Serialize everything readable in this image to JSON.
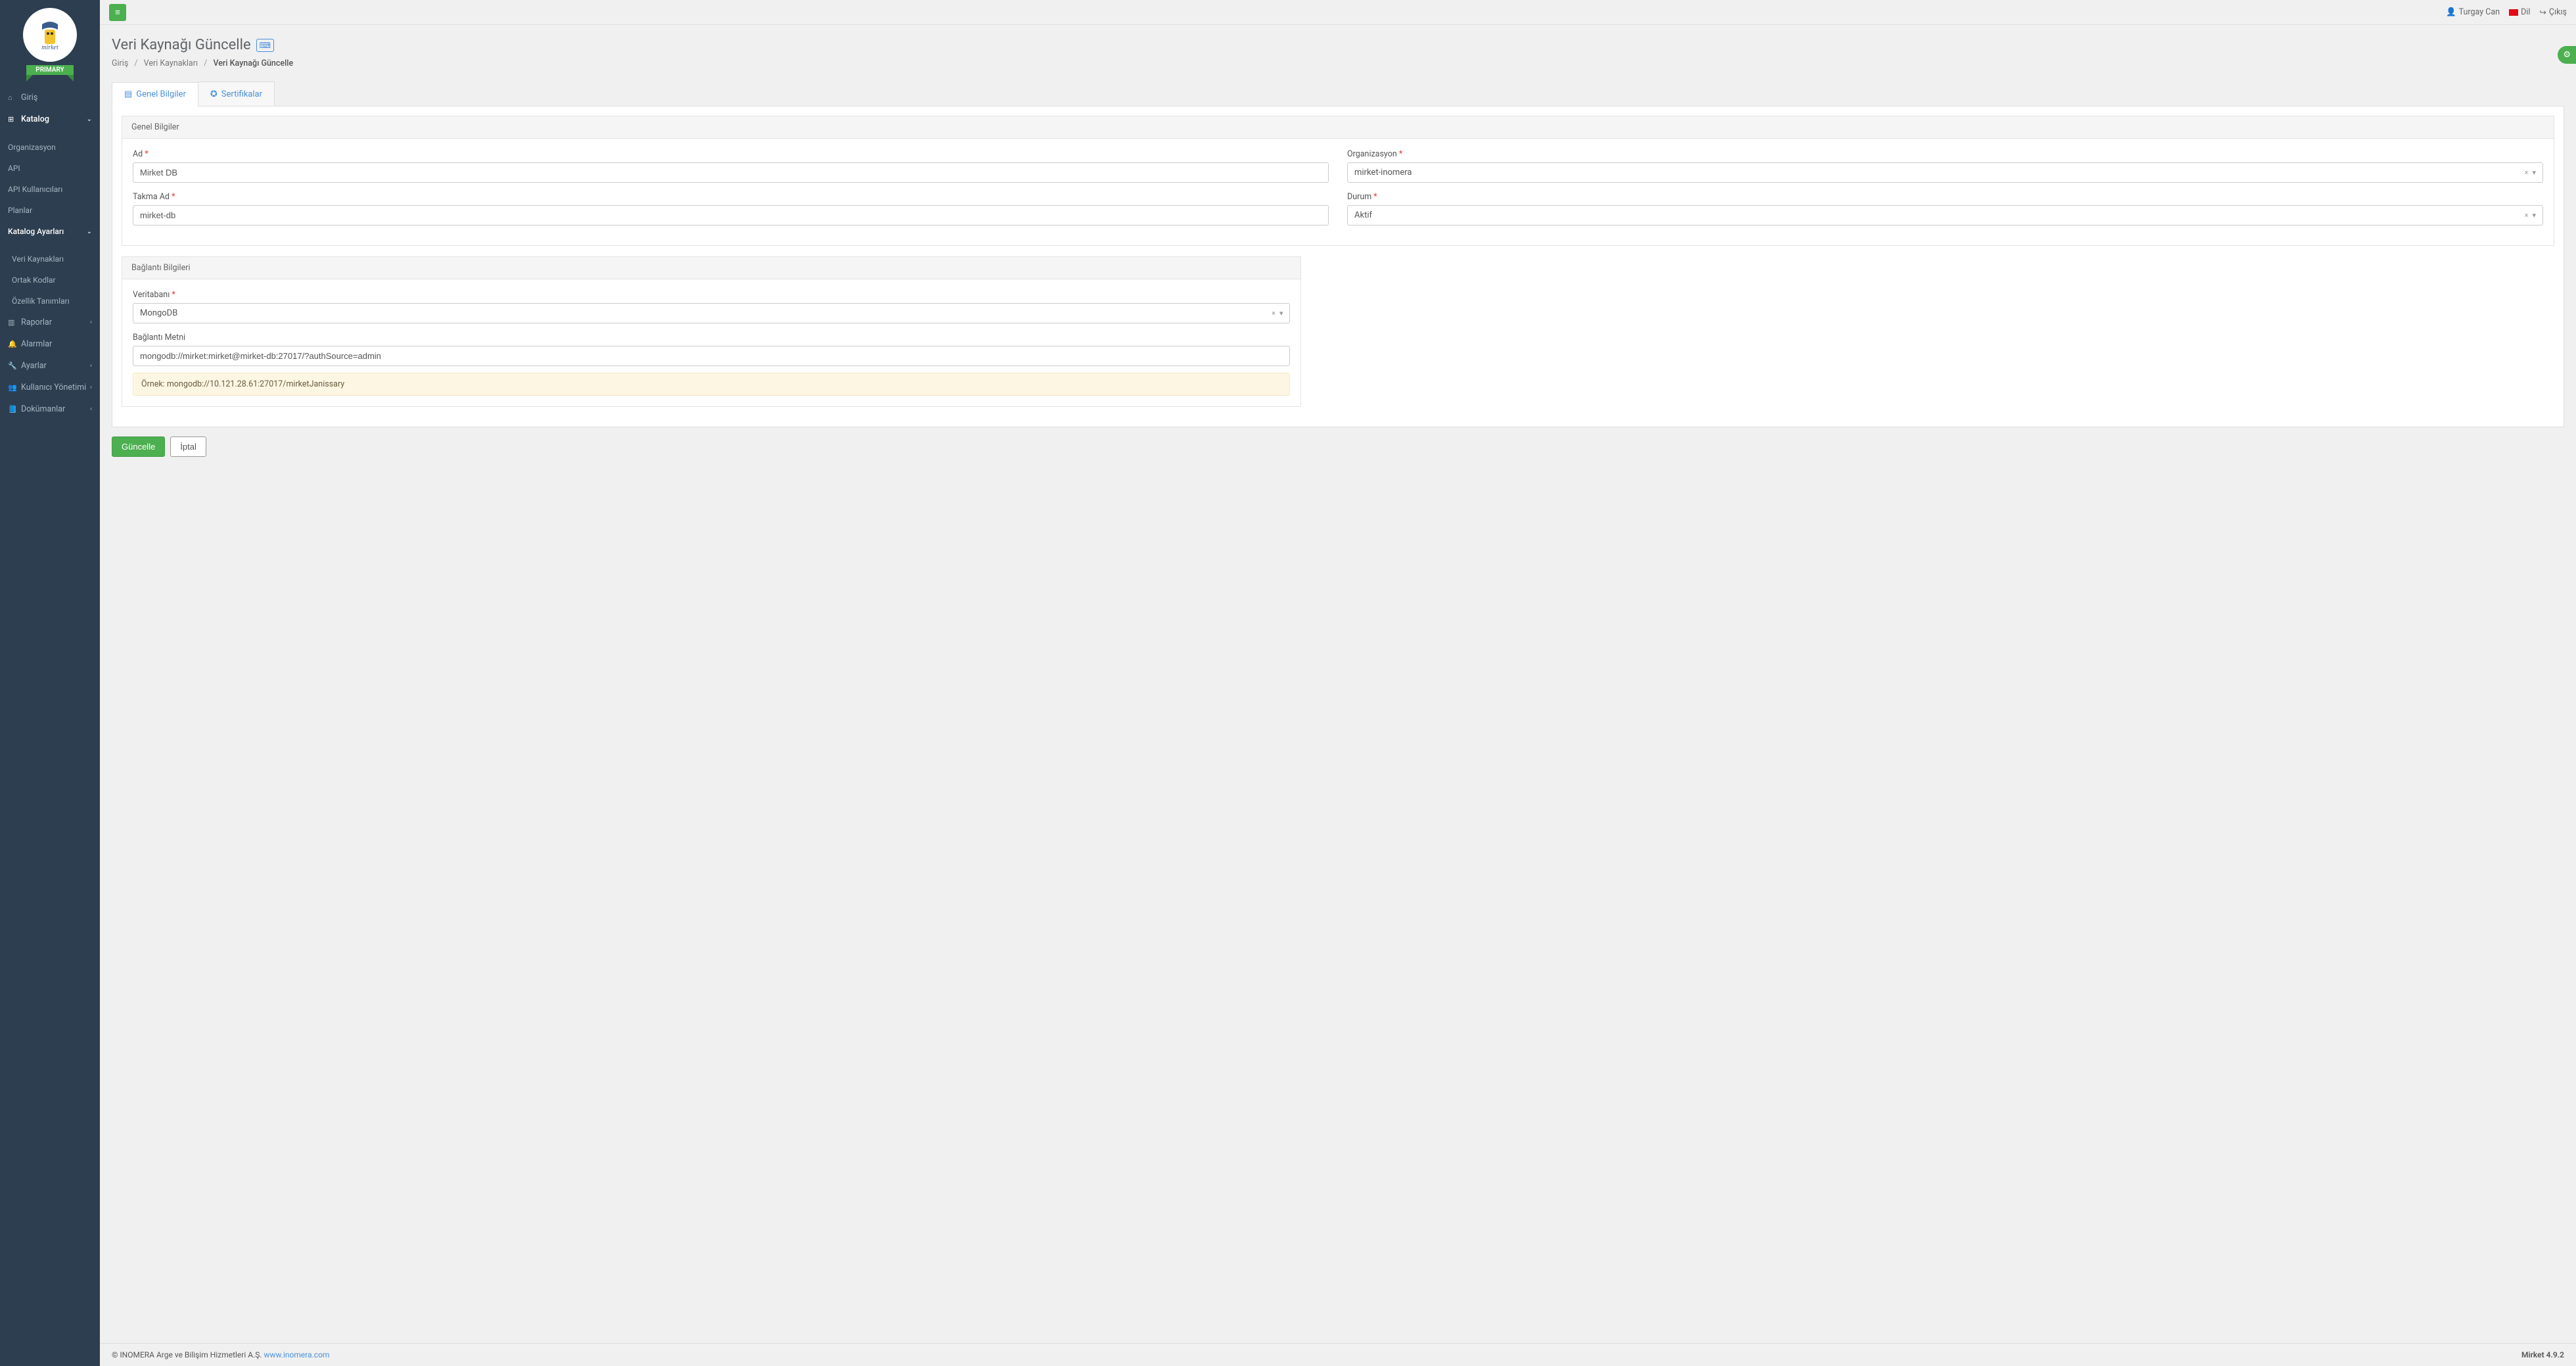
{
  "brand": {
    "badge": "PRIMARY"
  },
  "topbar": {
    "user": "Turgay Can",
    "language": "Dil",
    "logout": "Çıkış"
  },
  "sidebar": {
    "home": "Giriş",
    "catalog": "Katalog",
    "catalog_sub": {
      "organization": "Organizasyon",
      "api": "API",
      "api_users": "API Kullanıcıları",
      "plans": "Planlar",
      "catalog_settings": "Katalog Ayarları",
      "catalog_settings_sub": {
        "data_sources": "Veri Kaynakları",
        "shared_codes": "Ortak Kodlar",
        "feature_defs": "Özellik Tanımları"
      }
    },
    "reports": "Raporlar",
    "alarms": "Alarmlar",
    "settings": "Ayarlar",
    "user_mgmt": "Kullanıcı Yönetimi",
    "docs": "Dokümanlar"
  },
  "page": {
    "title": "Veri Kaynağı Güncelle",
    "breadcrumb": {
      "home": "Giriş",
      "data_sources": "Veri Kaynakları",
      "current": "Veri Kaynağı Güncelle"
    }
  },
  "tabs": {
    "general": "Genel Bilgiler",
    "certs": "Sertifikalar"
  },
  "form": {
    "general_legend": "Genel Bilgiler",
    "name_label": "Ad",
    "name_value": "Mirket DB",
    "org_label": "Organizasyon",
    "org_value": "mirket-inomera",
    "alias_label": "Takma Ad",
    "alias_value": "mirket-db",
    "status_label": "Durum",
    "status_value": "Aktif",
    "connection_legend": "Bağlantı Bilgileri",
    "db_label": "Veritabanı",
    "db_value": "MongoDB",
    "connstr_label": "Bağlantı Metni",
    "connstr_value": "mongodb://mirket:mirket@mirket-db:27017/?authSource=admin",
    "example": "Örnek: mongodb://10.121.28.61:27017/mirketJanissary"
  },
  "actions": {
    "update": "Güncelle",
    "cancel": "İptal"
  },
  "footer": {
    "copyright": "© INOMERA Arge ve Bilişim Hizmetleri A.Ş. ",
    "link": "www.inomera.com",
    "version": "Mirket 4.9.2"
  }
}
